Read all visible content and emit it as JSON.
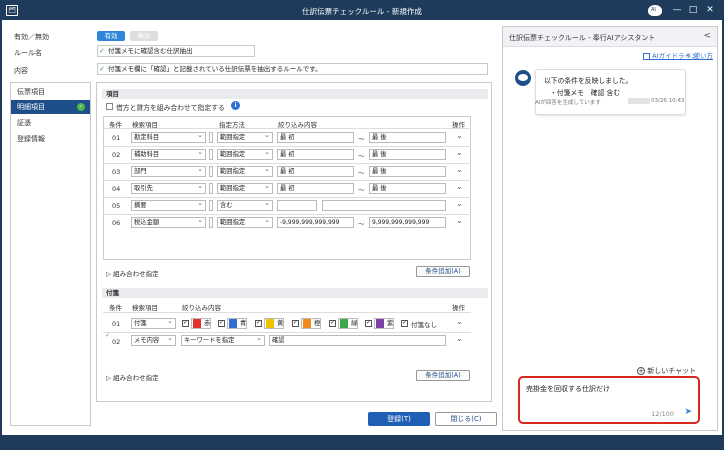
{
  "window": {
    "title": "仕訳伝票チェックルール - 新規作成",
    "logo_text": "🗂",
    "ai_icon_text": "AI",
    "min": "—",
    "max": "□",
    "close": "✕"
  },
  "header": {
    "enable_label": "有効／無効",
    "toggle_on": "有効",
    "toggle_off": "無効",
    "rule_name_label": "ルール名",
    "rule_name_value": "付箋メモに確認含む仕訳抽出",
    "content_label": "内容",
    "content_value": "付箋メモ欄に「確認」と記載されている仕訳伝票を抽出するルールです。"
  },
  "sidebar": {
    "items": [
      "伝票項目",
      "明細項目",
      "証憑",
      "登録情報"
    ],
    "active": "明細項目",
    "check": "✓"
  },
  "items_section": {
    "title": "項目",
    "combine_label": "借方と貸方を組み合わせて指定する",
    "info": "i",
    "headers": [
      "条件",
      "検索項目",
      "指定方法",
      "絞り込み内容",
      "操作"
    ],
    "rows": [
      {
        "no": "01",
        "item": "勘定科目",
        "method": "範囲指定",
        "from": "最 初",
        "tilde": "～",
        "to": "最 後"
      },
      {
        "no": "02",
        "item": "補助科目",
        "method": "範囲指定",
        "from": "最 初",
        "tilde": "～",
        "to": "最 後"
      },
      {
        "no": "03",
        "item": "部門",
        "method": "範囲指定",
        "from": "最 初",
        "tilde": "～",
        "to": "最 後"
      },
      {
        "no": "04",
        "item": "取引先",
        "method": "範囲指定",
        "from": "最 初",
        "tilde": "～",
        "to": "最 後"
      },
      {
        "no": "05",
        "item": "摘要",
        "method": "含む",
        "from": "",
        "tilde": "",
        "to": ""
      },
      {
        "no": "06",
        "item": "税込金額",
        "method": "範囲指定",
        "from": "-9,999,999,999,999",
        "tilde": "～",
        "to": "9,999,999,999,999"
      }
    ],
    "combo_label": "組み合わせ指定",
    "add_button": "条件追加(A)"
  },
  "fusen_section": {
    "title": "付箋",
    "headers": [
      "条件",
      "検索項目",
      "絞り込み内容",
      "操作"
    ],
    "row1": {
      "no": "01",
      "item": "付箋",
      "tags": [
        {
          "label": "赤",
          "color": "#e03030"
        },
        {
          "label": "青",
          "color": "#2f6fd0"
        },
        {
          "label": "黄",
          "color": "#f2c200"
        },
        {
          "label": "橙",
          "color": "#f08a1a"
        },
        {
          "label": "緑",
          "color": "#3aa84a"
        },
        {
          "label": "紫",
          "color": "#7d3fa8"
        }
      ],
      "none_label": "付箋なし"
    },
    "row2": {
      "no": "02",
      "item": "メモ内容",
      "method": "キーワードを指定",
      "keyword": "確認"
    },
    "combo_label": "組み合わせ指定",
    "add_button": "条件追加(A)"
  },
  "footer": {
    "register": "登録(T)",
    "close": "閉じる(C)"
  },
  "assistant": {
    "title": "仕訳伝票チェックルール - 奉行AIアシスタント",
    "collapse": "<",
    "guideline": "AIガイドライン",
    "howto": "使い方",
    "message_line1": "以下の条件を反映しました。",
    "message_line2": "・付箋メモ　確認 含む",
    "disclaimer": "AIが回答を生成しています",
    "timestamp": "03/26 10:43",
    "new_chat": "新しいチャット",
    "input_value": "売掛金を回収する仕訳だけ",
    "counter": "12/100",
    "send": "➤"
  },
  "colors": {
    "navy": "#1f3b5c",
    "accent": "#1f4f8b",
    "highlight": "#d6281f"
  }
}
